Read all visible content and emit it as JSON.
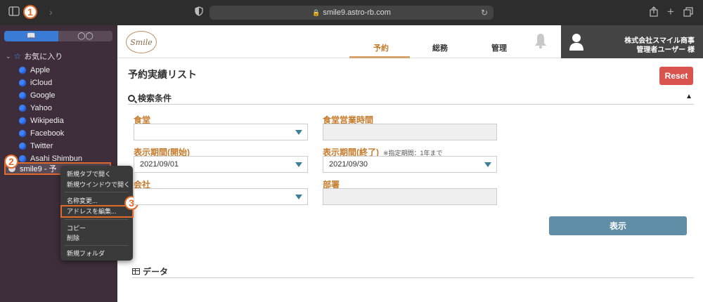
{
  "browser": {
    "url": "smile9.astro-rb.com"
  },
  "badges": {
    "b1": "1",
    "b2": "2",
    "b3": "3"
  },
  "sidebar": {
    "favorites_label": "お気に入り",
    "items": [
      {
        "label": "Apple"
      },
      {
        "label": "iCloud"
      },
      {
        "label": "Google"
      },
      {
        "label": "Yahoo"
      },
      {
        "label": "Wikipedia"
      },
      {
        "label": "Facebook"
      },
      {
        "label": "Twitter"
      },
      {
        "label": "Asahi Shimbun"
      }
    ],
    "selected_item": "smile9 - 予"
  },
  "context_menu": {
    "open_new_tab": "新規タブで開く",
    "open_new_window": "新規ウインドウで開く",
    "rename": "名称変更...",
    "edit_address": "アドレスを編集...",
    "copy": "コピー",
    "delete": "削除",
    "new_folder": "新規フォルダ"
  },
  "header": {
    "logo_text": "Smile",
    "tabs": [
      {
        "label": "予約"
      },
      {
        "label": "総務"
      },
      {
        "label": "管理"
      }
    ],
    "company": "株式会社スマイル商事",
    "user": "管理者ユーザー 様"
  },
  "main": {
    "title": "予約実績リスト",
    "reset_label": "Reset",
    "search_label": "検索条件",
    "fields": {
      "cafeteria_label": "食堂",
      "hours_label": "食堂営業時間",
      "start_label": "表示期間(開始)",
      "start_value": "2021/09/01",
      "end_label": "表示期間(終了)",
      "end_note": "※指定期間：1年まで",
      "end_value": "2021/09/30",
      "company_label": "会社",
      "dept_label": "部署"
    },
    "show_label": "表示",
    "data_label": "データ"
  },
  "colors": {
    "accent": "#c57a2a",
    "reset": "#d9534f",
    "show_button": "#5f8ea6",
    "highlight": "#e06a2a",
    "sidebar_bg": "#3e2e3b"
  }
}
